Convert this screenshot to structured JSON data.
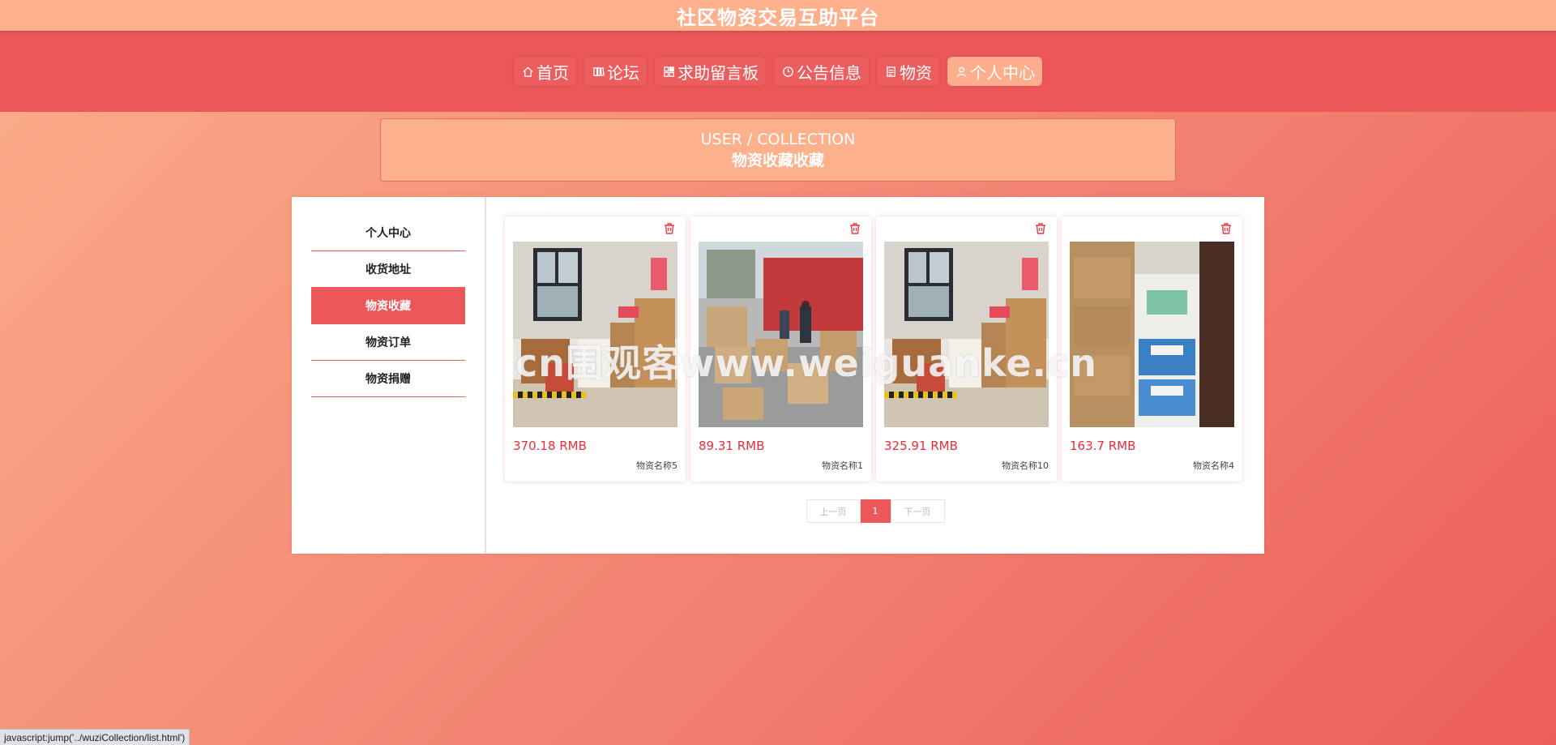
{
  "header": {
    "title": "社区物资交易互助平台"
  },
  "nav": {
    "items": [
      {
        "label": "首页",
        "icon": "home-icon"
      },
      {
        "label": "论坛",
        "icon": "book-icon"
      },
      {
        "label": "求助留言板",
        "icon": "grid-icon"
      },
      {
        "label": "公告信息",
        "icon": "clock-icon"
      },
      {
        "label": "物资",
        "icon": "note-icon"
      },
      {
        "label": "个人中心",
        "icon": "user-icon",
        "active": true
      }
    ]
  },
  "banner": {
    "en": "USER / COLLECTION",
    "cn": "物资收藏收藏"
  },
  "sidebar": {
    "items": [
      {
        "label": "个人中心"
      },
      {
        "label": "收货地址"
      },
      {
        "label": "物资收藏",
        "active": true
      },
      {
        "label": "物资订单"
      },
      {
        "label": "物资捐赠"
      }
    ]
  },
  "products": [
    {
      "price": "370.18 RMB",
      "name": "物资名称5"
    },
    {
      "price": "89.31 RMB",
      "name": "物资名称1"
    },
    {
      "price": "325.91 RMB",
      "name": "物资名称10"
    },
    {
      "price": "163.7 RMB",
      "name": "物资名称4"
    }
  ],
  "pager": {
    "prev": "上一页",
    "current": "1",
    "next": "下一页"
  },
  "watermark": "cn围观客www.weiguanke.cn",
  "status_url": "javascript:jump('../wuziCollection/list.html')",
  "colors": {
    "accent": "#ec575a",
    "nav_active": "#feae8c",
    "price": "#ec2d3a"
  }
}
